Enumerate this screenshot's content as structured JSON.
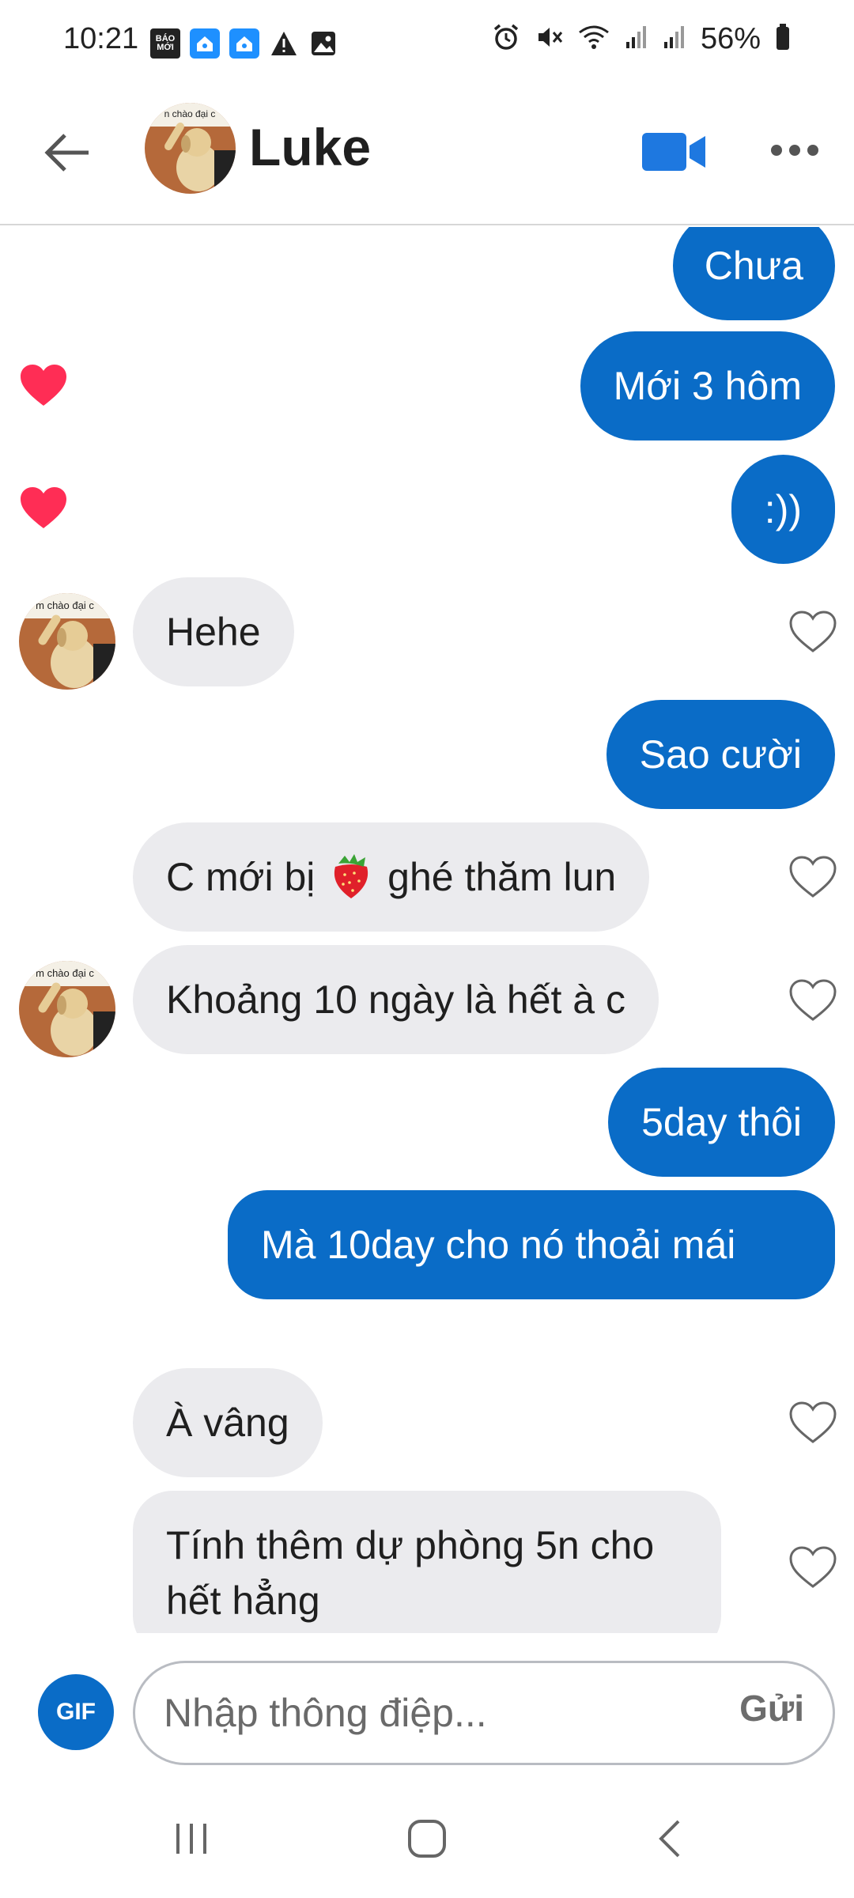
{
  "status_bar": {
    "time": "10:21",
    "battery_percent": "56%",
    "left_icons": [
      "bao-moi-icon",
      "home-notification-icon",
      "home-notification-icon",
      "warning-icon",
      "image-icon"
    ],
    "bao_moi_label_1": "BÁO",
    "bao_moi_label_2": "MỚI",
    "right_icons": [
      "alarm-icon",
      "mute-icon",
      "wifi-icon",
      "signal-icon",
      "signal-icon",
      "battery-icon"
    ]
  },
  "header": {
    "contact_name": "Luke",
    "avatar_caption": "n chào đại c",
    "icons": [
      "back-arrow-icon",
      "video-call-icon",
      "more-options-icon"
    ]
  },
  "messages": [
    {
      "direction": "out",
      "text": "Chưa"
    },
    {
      "direction": "out",
      "text": "Mới 3 hôm",
      "reaction": "heart"
    },
    {
      "direction": "out",
      "text": ":))",
      "reaction": "heart"
    },
    {
      "direction": "in",
      "text": "Hehe",
      "avatar": true
    },
    {
      "direction": "out",
      "text": "Sao cười"
    },
    {
      "direction": "in",
      "text_before": "C mới bị ",
      "emoji": "strawberry",
      "text_after": " ghé thăm lun"
    },
    {
      "direction": "in",
      "text": "Khoảng 10 ngày là hết à c",
      "avatar": true
    },
    {
      "direction": "out",
      "text": "5day thôi"
    },
    {
      "direction": "out",
      "text": "Mà 10day cho nó thoải mái"
    },
    {
      "direction": "in",
      "text": "À vâng"
    },
    {
      "direction": "in",
      "text": "Tính thêm dự phòng 5n cho hết hẳng"
    }
  ],
  "avatar_caption_small": "m chào đại c",
  "composer": {
    "gif_label": "GIF",
    "placeholder": "Nhập thông điệp...",
    "send_label": "Gửi"
  },
  "nav_bar": {
    "icons": [
      "recent-apps-icon",
      "home-icon",
      "back-icon"
    ]
  },
  "colors": {
    "outgoing_bubble": "#0a6cc7",
    "incoming_bubble": "#ebebee",
    "heart_reaction": "#ff2d55",
    "accent": "#1e78e0"
  }
}
